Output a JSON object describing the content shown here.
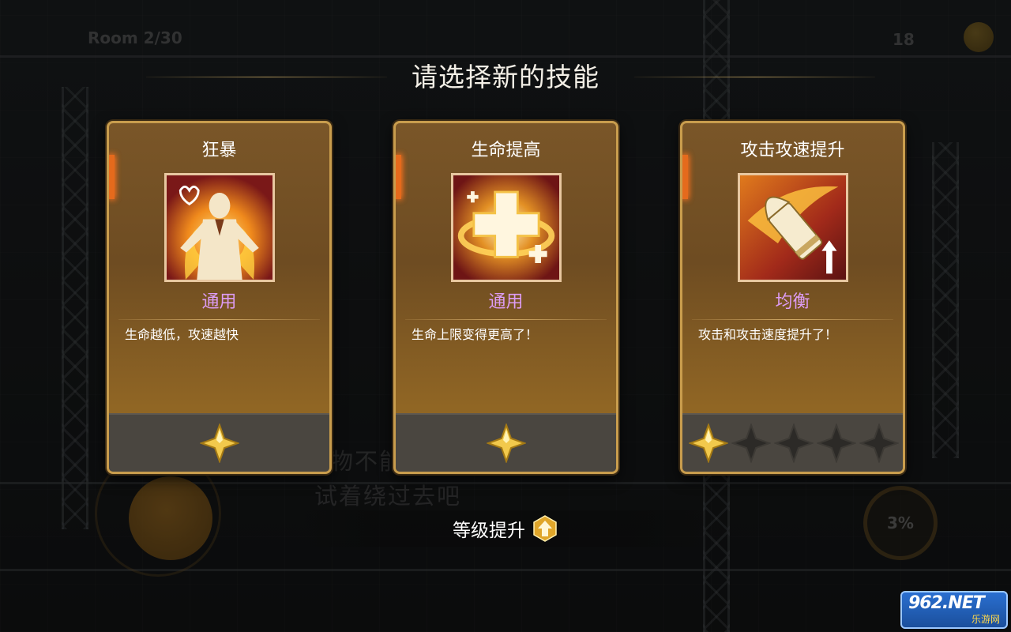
{
  "hud": {
    "room": "Room 2/30",
    "coins": "18",
    "hint": [
      "物不能",
      "试着绕过去吧"
    ],
    "ability_percent": "3%"
  },
  "header": {
    "title": "请选择新的技能"
  },
  "cards": [
    {
      "title": "狂暴",
      "icon": "berserk-icon",
      "type": "通用",
      "description": "生命越低，攻速越快",
      "stars_total": 1,
      "stars_filled": 1
    },
    {
      "title": "生命提高",
      "icon": "health-cross-icon",
      "type": "通用",
      "description": "生命上限变得更高了！",
      "stars_total": 1,
      "stars_filled": 1
    },
    {
      "title": "攻击攻速提升",
      "icon": "bullet-upgrade-icon",
      "type": "均衡",
      "description": "攻击和攻击速度提升了！",
      "stars_total": 5,
      "stars_filled": 1
    }
  ],
  "levelup": {
    "label": "等级提升",
    "icon": "level-up-arrow-icon"
  },
  "watermark": {
    "text": "962.NET",
    "sub": "乐游网"
  },
  "colors": {
    "card_border": "#c99d4d",
    "type_text": "#dd9cf4",
    "star_gold": "#f2c94c",
    "star_empty": "#2c2a27"
  }
}
